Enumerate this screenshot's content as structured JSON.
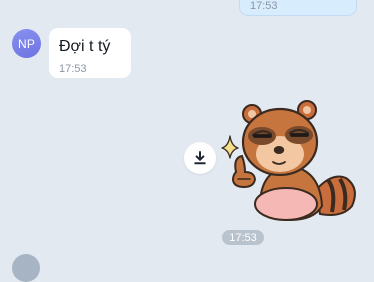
{
  "conversation": {
    "sent_message": {
      "time": "17:53"
    },
    "received_message": {
      "avatar_initials": "NP",
      "text": "Đợi t tý",
      "time": "17:53"
    },
    "sticker": {
      "icon": "thumbs-up-raccoon-sticker",
      "download_icon": "download-icon",
      "sparkle_icon": "sparkle-icon"
    },
    "timestamp_divider": "17:53"
  },
  "colors": {
    "background": "#e2e9f0",
    "sent_bubble": "#d7ecfd",
    "received_bubble": "#ffffff",
    "avatar": "#7a80ea",
    "time_pill": "#b9c3cd"
  }
}
